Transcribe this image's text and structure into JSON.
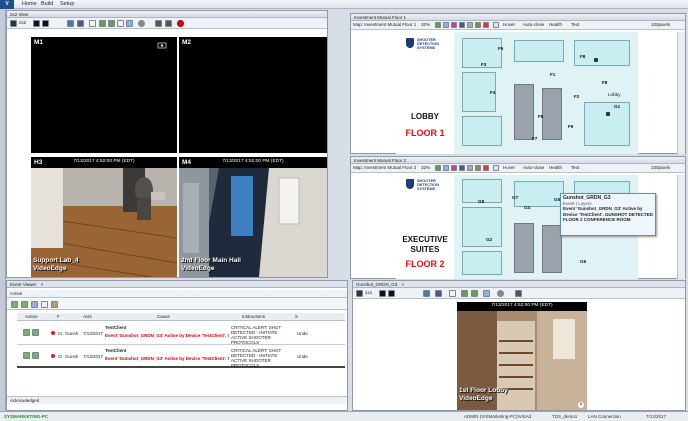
{
  "app": {
    "logo_text": "V",
    "menu": [
      "Home",
      "Build",
      "Setup"
    ]
  },
  "video_grid": {
    "title": "2x2 View",
    "layout_label": "2x2",
    "cells": [
      {
        "id": "M1",
        "timestamp": "",
        "caption_line1": "",
        "caption_line2": ""
      },
      {
        "id": "M2",
        "timestamp": "",
        "caption_line1": "",
        "caption_line2": ""
      },
      {
        "id": "H3",
        "timestamp": "7/13/2017 4:52:00 PM (EDT)",
        "caption_line1": "Support Lab_4",
        "caption_line2": "VideoEdge"
      },
      {
        "id": "M4",
        "timestamp": "7/13/2017 4:52:00 PM (EDT)",
        "caption_line1": "2nd Floor Main Hall",
        "caption_line2": "VideoEdge"
      }
    ]
  },
  "maps": {
    "top": {
      "title": "Investment Mutual Floor 1",
      "toolbar_map": "Map: Investment Mutual Floor 1",
      "zoom": "32%",
      "checks": [
        "Hover",
        "Auto-close",
        "Health",
        "Text"
      ],
      "scale": "100pixels",
      "brand": [
        "SHOOTER",
        "DETECTION",
        "SYSTEMS"
      ],
      "floor_title": "LOBBY",
      "floor_sub": "FLOOR 1",
      "labels": [
        "F3",
        "F6",
        "F8",
        "F9",
        "F8",
        "G1",
        "Lobby",
        "F4",
        "F5",
        "F7",
        "F1",
        "F2"
      ]
    },
    "bottom": {
      "title": "Investment Mutual Floor 2",
      "toolbar_map": "Map: Investment Mutual Floor 2",
      "zoom": "32%",
      "checks": [
        "Hover",
        "Auto-close",
        "Health",
        "Text"
      ],
      "scale": "100pixels",
      "brand": [
        "SHOOTER",
        "DETECTION",
        "SYSTEMS"
      ],
      "floor_title_1": "EXECUTIVE",
      "floor_title_2": "SUITES",
      "floor_sub": "FLOOR 2",
      "labels": [
        "G8",
        "G7",
        "G4",
        "G5",
        "G8",
        "G6",
        "G2",
        "G3"
      ]
    }
  },
  "popup": {
    "title": "Gunshot_GRDN_G3",
    "subtitle": "Event | Layers",
    "message": "Event 'Gunshot_GRDN_G3' Active by Device 'TestClient'. GUNSHOT DETECTED FLOOR 2 CONFERENCE ROOM"
  },
  "event_viewer": {
    "tab": "Event Viewer",
    "section_active": "Active",
    "section_ack": "Acknowledged",
    "columns": [
      "Action",
      "F",
      "Acts",
      "Cause",
      "Instructions",
      "S"
    ],
    "rows": [
      {
        "name": "Cr. Gunsh",
        "time": "7/13/2017",
        "source": "TestClient",
        "cause": "Event 'Gunshot_GRDN_G4' Active by Device 'TestClient'. G",
        "instructions": "CRITICAL ALERT: SHOT DETECTED - INITIATE ACTIVE SHOOTER PROTOCOLS",
        "state": "Unde"
      },
      {
        "name": "Cr. Gunsh",
        "time": "7/13/2017",
        "source": "TestClient",
        "cause": "Event 'Gunshot_GRDN_G3' Active by Device 'TestClient'. G",
        "instructions": "CRITICAL ALERT: SHOT DETECTED - INITIATE ACTIVE SHOOTER PROTOCOLS",
        "state": "Unde"
      }
    ]
  },
  "single_view": {
    "tab": "Gunshot_GRDN_G3",
    "layout_label": "1x1",
    "timestamp": "7/13/2017 4:52:00 PM (EDT)",
    "caption_line1": "1st Floor Lobby",
    "caption_line2": "VideoEdge"
  },
  "statusbar": {
    "left": "SYSMARKETING-PC",
    "user": "ADMIN (VISMarketing-PC)\\ViSAd",
    "server": "TDS_demo1",
    "connection": "LAN Connection",
    "datetime": "7/13/2017"
  },
  "colors": {
    "alert_red": "#d11111",
    "map_bg": "#dff3f5",
    "brand_blue": "#1b3e78"
  }
}
